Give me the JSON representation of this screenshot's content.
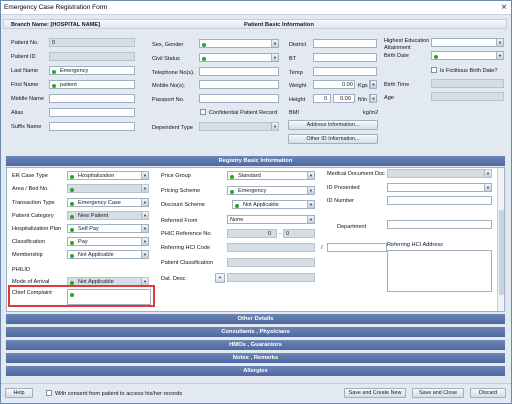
{
  "window": {
    "title": "Emergency Case Registration Form",
    "close": "×"
  },
  "branch": {
    "label": "Branch Name: [HOSPITAL NAME]",
    "header": "Patient Basic Information"
  },
  "basic": {
    "patient_no": {
      "label": "Patient No.",
      "value": "0"
    },
    "patient_id": {
      "label": "Patient ID"
    },
    "last_name": {
      "label": "Last Name",
      "value": "Emergency"
    },
    "first_name": {
      "label": "First Name",
      "value": "patient"
    },
    "middle_name": {
      "label": "Middle Name"
    },
    "alias": {
      "label": "Alias"
    },
    "suffix_name": {
      "label": "Suffix Name"
    },
    "sex_gender": {
      "label": "Sex, Gender"
    },
    "civil_status": {
      "label": "Civil Status"
    },
    "telephone": {
      "label": "Telephone No(s)."
    },
    "mobile": {
      "label": "Mobile No(s)."
    },
    "passport": {
      "label": "Passport No."
    },
    "confidential": {
      "label": "Confidential Patient Record"
    },
    "dependent_type": {
      "label": "Dependent Type"
    },
    "district": {
      "label": "District"
    },
    "bt": {
      "label": "BT"
    },
    "temp": {
      "label": "Temp"
    },
    "weight": {
      "label": "Weight",
      "value": "0.00",
      "unit": "Kgs"
    },
    "height": {
      "label": "Height",
      "v1": "0",
      "v2": "0.00",
      "unit": "ft/in"
    },
    "bmi": {
      "label": "BMI",
      "unit": "kg/m2"
    },
    "address_btn": "Address Information...",
    "other_id_btn": "Other ID Information...",
    "highest_education": {
      "label": "Highest Education Attainment"
    },
    "birth_date": {
      "label": "Birth Date"
    },
    "fictitious": {
      "label": "Is Fictitious Birth Date?"
    },
    "birth_time": {
      "label": "Birth Time"
    },
    "age": {
      "label": "Age"
    }
  },
  "registry": {
    "header": "Registry Basic Information",
    "er_case_type": {
      "label": "ER Case Type",
      "value": "Hospitalization"
    },
    "area_bed": {
      "label": "Area / Bed No."
    },
    "transaction_type": {
      "label": "Transaction Type",
      "value": "Emergency Case"
    },
    "patient_category": {
      "label": "Patient Category",
      "value": "New Patient"
    },
    "hosp_plan": {
      "label": "Hospitalization Plan",
      "value": "Self Pay"
    },
    "classification": {
      "label": "Classification",
      "value": "Pay"
    },
    "membership": {
      "label": "Membership",
      "value": "Not Applicable"
    },
    "philid": {
      "label": "PHILID"
    },
    "mode_arrival": {
      "label": "Mode of Arrival",
      "value": "Not Applicable"
    },
    "chief_complaint": {
      "label": "Chief Complaint"
    },
    "price_group": {
      "label": "Price Group",
      "value": "Standard"
    },
    "priority_scheme": {
      "label": "Pricing Scheme",
      "value": "Emergency"
    },
    "discount_scheme": {
      "label": "Discount Scheme",
      "value": "Not Applicable"
    },
    "referred_from": {
      "label": "Referred From",
      "value": "None"
    },
    "philhealth_ref": {
      "label": "PHIC Reference No.",
      "v1": "0",
      "v2": "0"
    },
    "referring_hci": {
      "label": "Referring HCI Code"
    },
    "patient_classification": {
      "label": "Patient Classification"
    },
    "dat_desc": {
      "label": "Dat. Desc"
    },
    "medical_doctor": {
      "label": "Medical Document Doc"
    },
    "id_presented": {
      "label": "ID Presented"
    },
    "id_number": {
      "label": "ID Number"
    },
    "department": {
      "label": "Department"
    },
    "referring_hci_address": {
      "label": "Referring HCI Address"
    },
    "slash": "/"
  },
  "sections": [
    "Other Details",
    "Consultants , Physicians",
    "HMOs , Guarantors",
    "Notes , Remarks",
    "Allergies"
  ],
  "footer": {
    "help": "Help",
    "consent": "With consent from patient to access his/her records",
    "save_new": "Save and Create New",
    "save_close": "Save and Close",
    "discard": "Discard"
  }
}
